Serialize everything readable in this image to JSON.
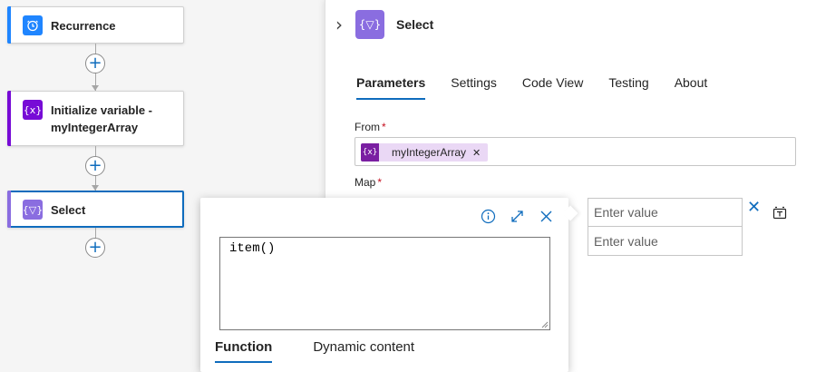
{
  "flow": {
    "nodes": [
      {
        "label": "Recurrence",
        "icon": "clock-icon",
        "color": "#1f85ff"
      },
      {
        "label": "Initialize variable - myIntegerArray",
        "icon": "variable-icon",
        "color": "#770bd6"
      },
      {
        "label": "Select",
        "icon": "select-icon",
        "color": "#8a6de0"
      }
    ]
  },
  "panel": {
    "title": "Select",
    "tabs": [
      "Parameters",
      "Settings",
      "Code View",
      "Testing",
      "About"
    ],
    "active_tab": "Parameters",
    "from": {
      "label": "From",
      "required_mark": "*",
      "token": "myIntegerArray"
    },
    "map": {
      "label": "Map",
      "required_mark": "*",
      "value_placeholders": [
        "Enter value",
        "Enter value"
      ]
    }
  },
  "expression_editor": {
    "value": "item()",
    "tabs": [
      "Function",
      "Dynamic content"
    ],
    "active_tab": "Function"
  },
  "colors": {
    "accent": "#0f6cbd",
    "trigger": "#1f85ff",
    "variable": "#770bd6",
    "select": "#8a6de0",
    "required": "#c50f1f"
  }
}
